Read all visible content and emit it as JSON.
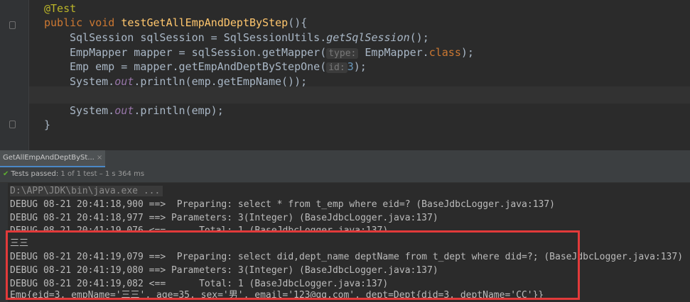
{
  "editor": {
    "annotation": "@Test",
    "method_kw": "public void ",
    "method_name": "testGetAllEmpAndDeptByStep",
    "method_tail": "(){",
    "l3_a": "SqlSession sqlSession = SqlSessionUtils.",
    "l3_b": "getSqlSession",
    "l3_c": "();",
    "l4_a": "EmpMapper mapper = sqlSession.getMapper(",
    "l4_hint": "type:",
    "l4_b": " EmpMapper.",
    "l4_kw": "class",
    "l4_c": ");",
    "l5_a": "Emp emp = mapper.getEmpAndDeptByStepOne(",
    "l5_hint": "id:",
    "l5_num": "3",
    "l5_c": ");",
    "l6_a": "System.",
    "l6_out": "out",
    "l6_b": ".println(emp.getEmpName());",
    "l8_a": "System.",
    "l8_out": "out",
    "l8_b": ".println(emp);",
    "l9": "}"
  },
  "run_tab": {
    "label": "GetAllEmpAndDeptBySt...",
    "close": "×"
  },
  "status": {
    "passed": "Tests passed:",
    "detail": " 1 of 1 test – 1 s 364 ms"
  },
  "console": {
    "cmd": "D:\\APP\\JDK\\bin\\java.exe ...",
    "lines": [
      "DEBUG 08-21 20:41:18,900 ==>  Preparing: select * from t_emp where eid=? (BaseJdbcLogger.java:137)",
      "DEBUG 08-21 20:41:18,977 ==> Parameters: 3(Integer) (BaseJdbcLogger.java:137)",
      "DEBUG 08-21 20:41:19,076 <==      Total: 1 (BaseJdbcLogger.java:137)",
      "三三",
      "DEBUG 08-21 20:41:19,079 ==>  Preparing: select did,dept_name deptName from t_dept where did=?; (BaseJdbcLogger.java:137)",
      "DEBUG 08-21 20:41:19,080 ==> Parameters: 3(Integer) (BaseJdbcLogger.java:137)",
      "DEBUG 08-21 20:41:19,082 <==      Total: 1 (BaseJdbcLogger.java:137)",
      "Emp{eid=3, empName='三三', age=35, sex='男', email='123@qq.com', dept=Dept{did=3, deptName='CC'}}"
    ]
  },
  "colors": {
    "background": "#2b2b2b",
    "keyword": "#cc7832",
    "method": "#ffc66d",
    "annotation": "#bbb529",
    "number": "#6897bb",
    "field": "#9876aa",
    "pass": "#5fb030",
    "highlight_border": "#e23a3a"
  }
}
